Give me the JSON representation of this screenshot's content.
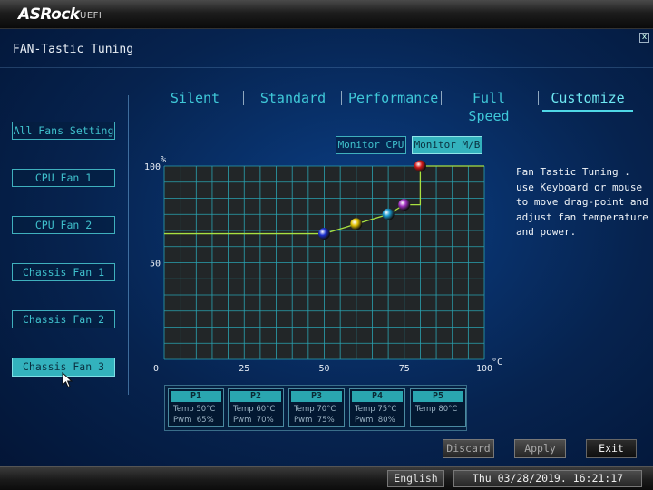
{
  "brand": {
    "name": "ASRock",
    "sub": "UEFI"
  },
  "window": {
    "title": "FAN-Tastic Tuning",
    "close_glyph": "x"
  },
  "tabs": [
    {
      "label": "Silent",
      "active": false
    },
    {
      "label": "Standard",
      "active": false
    },
    {
      "label": "Performance",
      "active": false
    },
    {
      "label": "Full Speed",
      "active": false
    },
    {
      "label": "Customize",
      "active": true
    }
  ],
  "fans": [
    {
      "label": "All Fans Setting",
      "active": false
    },
    {
      "label": "CPU Fan 1",
      "active": false
    },
    {
      "label": "CPU Fan 2",
      "active": false
    },
    {
      "label": "Chassis Fan 1",
      "active": false
    },
    {
      "label": "Chassis Fan 2",
      "active": false
    },
    {
      "label": "Chassis Fan 3",
      "active": true
    }
  ],
  "monitor": {
    "cpu_label": "Monitor CPU",
    "mb_label": "Monitor M/B",
    "selected": "Monitor M/B"
  },
  "chart_data": {
    "type": "line",
    "x_unit": "°C",
    "y_unit": "%",
    "xlim": [
      0,
      100
    ],
    "ylim": [
      0,
      100
    ],
    "x_ticks": [
      "0",
      "25",
      "50",
      "75",
      "100"
    ],
    "y_ticks": [
      "0",
      "50",
      "100"
    ],
    "grid": true,
    "points": [
      {
        "name": "P1",
        "x": 50,
        "y": 65,
        "color": "#1a2fd0"
      },
      {
        "name": "P2",
        "x": 60,
        "y": 70,
        "color": "#e0c000"
      },
      {
        "name": "P3",
        "x": 70,
        "y": 75,
        "color": "#1a9ad0"
      },
      {
        "name": "P4",
        "x": 75,
        "y": 80,
        "color": "#a030c0"
      },
      {
        "name": "P5",
        "x": 80,
        "y": 100,
        "color": "#d01818"
      }
    ],
    "line_color": "#a8e040"
  },
  "description": "Fan Tastic Tuning . use Keyboard or mouse to move drag-point and adjust fan temperature and power.",
  "point_cards": [
    {
      "name": "P1",
      "temp": "Temp 50°C",
      "pwm": "Pwm  65%"
    },
    {
      "name": "P2",
      "temp": "Temp 60°C",
      "pwm": "Pwm  70%"
    },
    {
      "name": "P3",
      "temp": "Temp 70°C",
      "pwm": "Pwm  75%"
    },
    {
      "name": "P4",
      "temp": "Temp 75°C",
      "pwm": "Pwm  80%"
    },
    {
      "name": "P5",
      "temp": "Temp 80°C",
      "pwm": ""
    }
  ],
  "actions": {
    "discard": "Discard",
    "apply": "Apply",
    "exit": "Exit"
  },
  "status": {
    "language": "English",
    "datetime": "Thu 03/28/2019. 16:21:17"
  }
}
